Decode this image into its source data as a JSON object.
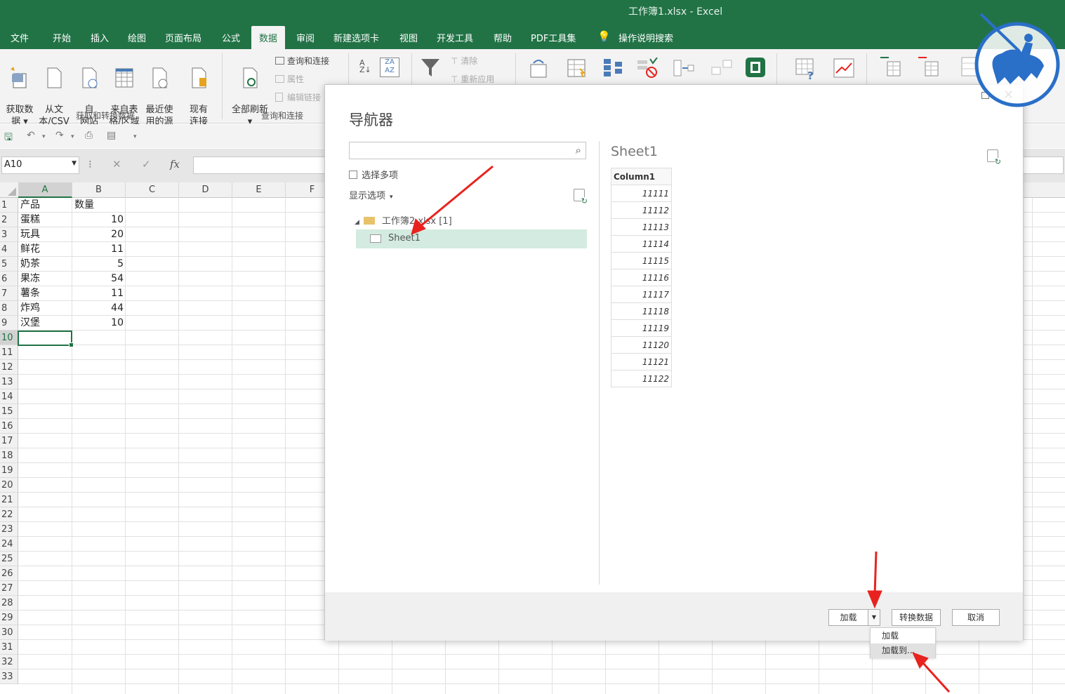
{
  "window_title": "工作簿1.xlsx  -  Excel",
  "menu": [
    "文件",
    "开始",
    "插入",
    "绘图",
    "页面布局",
    "公式",
    "数据",
    "审阅",
    "新建选项卡",
    "视图",
    "开发工具",
    "帮助",
    "PDF工具集"
  ],
  "active_menu": "数据",
  "tell_me": "操作说明搜索",
  "ribbon": {
    "get_data": "获取数\n据 ▾",
    "from_text": "从文\n本/CSV",
    "from_web": "自\n网站",
    "from_table": "来自表\n格/区域",
    "recent": "最近使\n用的源",
    "existing": "现有\n连接",
    "group1": "获取和转换数据",
    "refresh_all": "全部刷新\n▾",
    "queries": "查询和连接",
    "properties": "属性",
    "edit_links": "编辑链接",
    "group2": "查询和连接",
    "clear": "清除",
    "reapply": "重新应用"
  },
  "name_box": "A10",
  "fx_label": "fx",
  "columns": [
    "A",
    "B",
    "C",
    "D",
    "E",
    "F"
  ],
  "rows": [
    {
      "n": "1",
      "a": "产品",
      "b": "数量"
    },
    {
      "n": "2",
      "a": "蛋糕",
      "b": "10"
    },
    {
      "n": "3",
      "a": "玩具",
      "b": "20"
    },
    {
      "n": "4",
      "a": "鲜花",
      "b": "11"
    },
    {
      "n": "5",
      "a": "奶茶",
      "b": "5"
    },
    {
      "n": "6",
      "a": "果冻",
      "b": "54"
    },
    {
      "n": "7",
      "a": "薯条",
      "b": "11"
    },
    {
      "n": "8",
      "a": "炸鸡",
      "b": "44"
    },
    {
      "n": "9",
      "a": "汉堡",
      "b": "10"
    },
    {
      "n": "10",
      "a": "",
      "b": ""
    },
    {
      "n": "11"
    },
    {
      "n": "12"
    },
    {
      "n": "13"
    },
    {
      "n": "14"
    },
    {
      "n": "15"
    },
    {
      "n": "16"
    },
    {
      "n": "17"
    },
    {
      "n": "18"
    },
    {
      "n": "19"
    },
    {
      "n": "20"
    },
    {
      "n": "21"
    },
    {
      "n": "22"
    },
    {
      "n": "23"
    },
    {
      "n": "24"
    },
    {
      "n": "25"
    },
    {
      "n": "26"
    },
    {
      "n": "27"
    },
    {
      "n": "28"
    },
    {
      "n": "29"
    },
    {
      "n": "30"
    },
    {
      "n": "31"
    },
    {
      "n": "32"
    },
    {
      "n": "33"
    }
  ],
  "navigator": {
    "title": "导航器",
    "search_placeholder": "",
    "select_multiple": "选择多项",
    "display_options": "显示选项",
    "tree_root": "工作簿2.xlsx [1]",
    "tree_sheet": "Sheet1",
    "preview_title": "Sheet1",
    "preview_header": "Column1",
    "preview_values": [
      "11111",
      "11112",
      "11113",
      "11114",
      "11115",
      "11116",
      "11117",
      "11118",
      "11119",
      "11120",
      "11121",
      "11122"
    ],
    "load": "加载",
    "transform": "转换数据",
    "cancel": "取消",
    "dropdown": [
      "加载",
      "加载到..."
    ]
  },
  "colors": {
    "excel_green": "#217346",
    "annotation_red": "#e8231f"
  }
}
